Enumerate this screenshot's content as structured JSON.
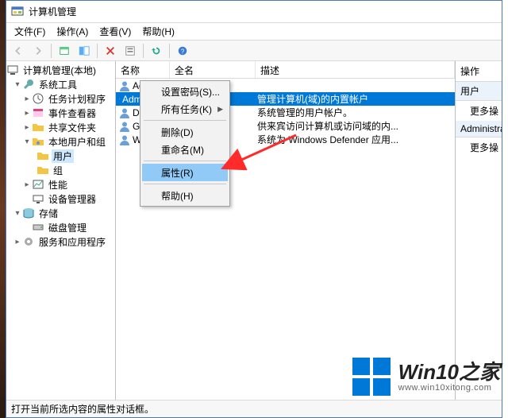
{
  "window": {
    "title": "计算机管理"
  },
  "menubar": {
    "file": "文件(F)",
    "action": "操作(A)",
    "view": "查看(V)",
    "help": "帮助(H)"
  },
  "tree": {
    "root": "计算机管理(本地)",
    "sys_tools": "系统工具",
    "task_sched": "任务计划程序",
    "event_viewer": "事件查看器",
    "shared": "共享文件夹",
    "local_users": "本地用户和组",
    "users": "用户",
    "groups": "组",
    "perf": "性能",
    "devmgr": "设备管理器",
    "storage": "存储",
    "diskmgr": "磁盘管理",
    "services": "服务和应用程序"
  },
  "list": {
    "col_name": "名称",
    "col_full": "全名",
    "col_desc": "描述",
    "rows": [
      {
        "name": "Admin",
        "full": "",
        "desc": ""
      },
      {
        "name": "Administrat",
        "full": "",
        "desc": "管理计算机(域)的内置帐户"
      },
      {
        "name": "De",
        "full": "",
        "desc": "系统管理的用户帐户。"
      },
      {
        "name": "Gu",
        "full": "",
        "desc": "供来宾访问计算机或访问域的内..."
      },
      {
        "name": "W",
        "full": "",
        "desc": "系统为 Windows Defender 应用..."
      }
    ]
  },
  "context": {
    "set_pwd": "设置密码(S)...",
    "all_tasks": "所有任务(K)",
    "delete": "删除(D)",
    "rename": "重命名(M)",
    "properties": "属性(R)",
    "help": "帮助(H)"
  },
  "actions": {
    "header": "操作",
    "group1": "用户",
    "more1": "更多操",
    "group2": "Administrat",
    "more2": "更多操"
  },
  "statusbar": {
    "text": "打开当前所选内容的属性对话框。"
  },
  "watermark": {
    "brand": "Win10之家",
    "url": "www.win10xitong.com"
  }
}
